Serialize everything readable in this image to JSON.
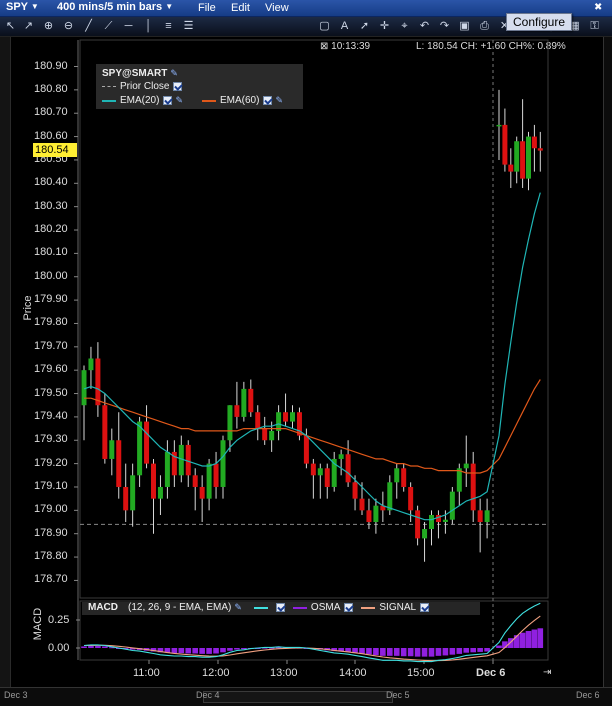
{
  "menu": {
    "symbol": "SPY",
    "timeframe": "400 mins/5 min bars",
    "items": [
      "File",
      "Edit",
      "View"
    ],
    "badges": [
      "T",
      "T",
      "T",
      "T"
    ],
    "tooltip": "Configure"
  },
  "status": {
    "time": "10:13:39",
    "quote": "L: 180.54 CH: +1.60 CH%: 0.89%"
  },
  "price_tag": "180.54",
  "price_axis": {
    "title": "Price",
    "ticks": [
      "180.90",
      "180.80",
      "180.70",
      "180.60",
      "180.50",
      "180.40",
      "180.30",
      "180.20",
      "180.10",
      "180.00",
      "179.90",
      "179.80",
      "179.70",
      "179.60",
      "179.50",
      "179.40",
      "179.30",
      "179.20",
      "179.10",
      "179.00",
      "178.90",
      "178.80",
      "178.70"
    ]
  },
  "time_axis": [
    "11:00",
    "12:00",
    "13:00",
    "14:00",
    "15:00",
    "Dec 6"
  ],
  "legend": {
    "title": "SPY@SMART",
    "prior_close": "Prior Close",
    "ema20": "EMA(20)",
    "ema60": "EMA(60)"
  },
  "macd": {
    "title": "MACD",
    "params": "(12, 26, 9 - EMA, EMA)",
    "osma": "OSMA",
    "signal": "SIGNAL",
    "axis_title": "MACD",
    "ticks": [
      "0.25",
      "0.00"
    ]
  },
  "bottom": {
    "labels": [
      "Dec 3",
      "Dec 4",
      "Dec 5",
      "Dec 6"
    ]
  },
  "colors": {
    "up": "#22aa22",
    "down": "#dd1111",
    "ema20": "#1fb5b5",
    "ema60": "#e0581a",
    "osma": "#9020e0",
    "signal": "#f0a080",
    "macd_line": "#40e0e0",
    "price_tag": "#ffee33"
  },
  "chart_data": {
    "type": "candlestick",
    "ylim": [
      178.65,
      180.95
    ],
    "bars": [
      [
        179.45,
        179.62,
        179.3,
        179.6
      ],
      [
        179.6,
        179.7,
        179.52,
        179.65
      ],
      [
        179.65,
        179.72,
        179.4,
        179.45
      ],
      [
        179.45,
        179.5,
        179.2,
        179.22
      ],
      [
        179.22,
        179.35,
        179.15,
        179.3
      ],
      [
        179.3,
        179.42,
        179.05,
        179.1
      ],
      [
        179.1,
        179.2,
        178.95,
        179.0
      ],
      [
        179.0,
        179.2,
        178.93,
        179.15
      ],
      [
        179.15,
        179.4,
        179.1,
        179.38
      ],
      [
        179.38,
        179.45,
        179.18,
        179.2
      ],
      [
        179.2,
        179.22,
        178.9,
        179.05
      ],
      [
        179.05,
        179.15,
        178.98,
        179.1
      ],
      [
        179.1,
        179.3,
        179.05,
        179.25
      ],
      [
        179.25,
        179.3,
        179.1,
        179.15
      ],
      [
        179.15,
        179.32,
        179.12,
        179.28
      ],
      [
        179.28,
        179.3,
        179.1,
        179.15
      ],
      [
        179.15,
        179.18,
        179.0,
        179.1
      ],
      [
        179.1,
        179.15,
        178.95,
        179.05
      ],
      [
        179.05,
        179.22,
        179.0,
        179.2
      ],
      [
        179.2,
        179.25,
        179.05,
        179.1
      ],
      [
        179.1,
        179.32,
        179.05,
        179.3
      ],
      [
        179.3,
        179.45,
        179.25,
        179.45
      ],
      [
        179.45,
        179.55,
        179.35,
        179.4
      ],
      [
        179.4,
        179.55,
        179.38,
        179.52
      ],
      [
        179.52,
        179.56,
        179.4,
        179.42
      ],
      [
        179.42,
        179.45,
        179.3,
        179.35
      ],
      [
        179.35,
        179.4,
        179.28,
        179.3
      ],
      [
        179.3,
        179.38,
        179.25,
        179.34
      ],
      [
        179.34,
        179.45,
        179.3,
        179.42
      ],
      [
        179.42,
        179.5,
        179.36,
        179.38
      ],
      [
        179.38,
        179.45,
        179.35,
        179.42
      ],
      [
        179.42,
        179.44,
        179.3,
        179.32
      ],
      [
        179.32,
        179.35,
        179.18,
        179.2
      ],
      [
        179.2,
        179.22,
        179.05,
        179.15
      ],
      [
        179.15,
        179.2,
        179.05,
        179.18
      ],
      [
        179.18,
        179.2,
        179.05,
        179.1
      ],
      [
        179.1,
        179.25,
        179.08,
        179.22
      ],
      [
        179.22,
        179.26,
        179.15,
        179.24
      ],
      [
        179.24,
        179.3,
        179.1,
        179.12
      ],
      [
        179.12,
        179.15,
        179.0,
        179.05
      ],
      [
        179.05,
        179.12,
        178.98,
        179.0
      ],
      [
        179.0,
        179.05,
        178.92,
        178.95
      ],
      [
        178.95,
        179.05,
        178.9,
        179.02
      ],
      [
        179.02,
        179.08,
        178.95,
        179.0
      ],
      [
        179.0,
        179.15,
        178.98,
        179.12
      ],
      [
        179.12,
        179.2,
        179.05,
        179.18
      ],
      [
        179.18,
        179.2,
        179.08,
        179.1
      ],
      [
        179.1,
        179.12,
        178.95,
        179.0
      ],
      [
        179.0,
        179.02,
        178.85,
        178.88
      ],
      [
        178.88,
        178.95,
        178.78,
        178.92
      ],
      [
        178.92,
        179.0,
        178.85,
        178.98
      ],
      [
        178.98,
        179.0,
        178.88,
        178.95
      ],
      [
        178.95,
        179.0,
        178.9,
        178.96
      ],
      [
        178.96,
        179.1,
        178.94,
        179.08
      ],
      [
        179.08,
        179.2,
        179.02,
        179.18
      ],
      [
        179.18,
        179.32,
        179.1,
        179.2
      ],
      [
        179.2,
        179.25,
        178.95,
        179.0
      ],
      [
        179.0,
        179.05,
        178.82,
        178.95
      ],
      [
        178.95,
        179.05,
        178.88,
        179.0
      ],
      [
        180.65,
        180.8,
        180.5,
        180.65
      ],
      [
        180.65,
        180.72,
        180.45,
        180.48
      ],
      [
        180.48,
        180.55,
        180.38,
        180.45
      ],
      [
        180.45,
        180.6,
        180.4,
        180.58
      ],
      [
        180.58,
        180.76,
        180.38,
        180.42
      ],
      [
        180.42,
        180.62,
        180.37,
        180.6
      ],
      [
        180.6,
        180.65,
        180.45,
        180.55
      ],
      [
        180.55,
        180.62,
        180.45,
        180.54
      ]
    ],
    "ema20": [
      179.52,
      179.53,
      179.52,
      179.5,
      179.47,
      179.44,
      179.41,
      179.38,
      179.36,
      179.33,
      179.3,
      179.27,
      179.25,
      179.23,
      179.22,
      179.21,
      179.2,
      179.19,
      179.19,
      179.2,
      179.23,
      179.27,
      179.3,
      179.32,
      179.34,
      179.35,
      179.36,
      179.36,
      179.37,
      179.36,
      179.35,
      179.34,
      179.32,
      179.29,
      179.26,
      179.23,
      179.2,
      179.18,
      179.16,
      179.13,
      179.1,
      179.07,
      179.04,
      179.02,
      179.01,
      179.0,
      178.99,
      178.98,
      178.97,
      178.96,
      178.96,
      178.97,
      178.98,
      179.0,
      179.02,
      179.04,
      179.05,
      179.06,
      179.08,
      179.32,
      179.54,
      179.72,
      179.89,
      180.04,
      180.16,
      180.27,
      180.36
    ],
    "ema60": [
      179.48,
      179.48,
      179.47,
      179.46,
      179.45,
      179.44,
      179.43,
      179.42,
      179.41,
      179.4,
      179.39,
      179.38,
      179.37,
      179.36,
      179.35,
      179.35,
      179.34,
      179.34,
      179.34,
      179.34,
      179.34,
      179.34,
      179.34,
      179.35,
      179.35,
      179.35,
      179.35,
      179.35,
      179.35,
      179.35,
      179.34,
      179.33,
      179.32,
      179.31,
      179.3,
      179.29,
      179.28,
      179.27,
      179.26,
      179.25,
      179.24,
      179.23,
      179.22,
      179.22,
      179.21,
      179.2,
      179.2,
      179.19,
      179.19,
      179.18,
      179.18,
      179.17,
      179.17,
      179.17,
      179.17,
      179.16,
      179.16,
      179.16,
      179.17,
      179.22,
      179.27,
      179.32,
      179.37,
      179.42,
      179.47,
      179.52,
      179.56
    ],
    "prior_close": 178.94,
    "macd_ylim": [
      -0.08,
      0.38
    ]
  }
}
